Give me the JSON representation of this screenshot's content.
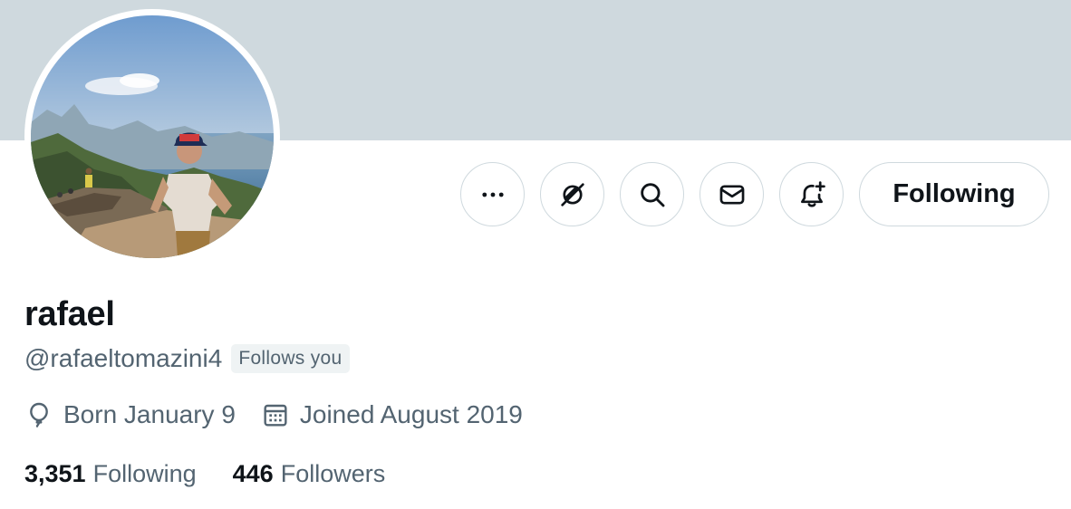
{
  "profile": {
    "name": "rafael",
    "handle": "@rafaeltomazini4",
    "follows_you_badge": "Follows you",
    "born": "Born January 9",
    "joined": "Joined August 2019",
    "following_count": "3,351",
    "following_label": "Following",
    "followers_count": "446",
    "followers_label": "Followers"
  },
  "actions": {
    "icons": [
      "more-icon",
      "unlink-icon",
      "search-icon",
      "mail-icon",
      "notification-bell-icon"
    ],
    "follow_button_label": "Following"
  },
  "colors": {
    "banner": "#cfd9de",
    "text_primary": "#0f1419",
    "text_secondary": "#536471",
    "border": "#cfd9de",
    "badge_bg": "#eff3f4"
  }
}
